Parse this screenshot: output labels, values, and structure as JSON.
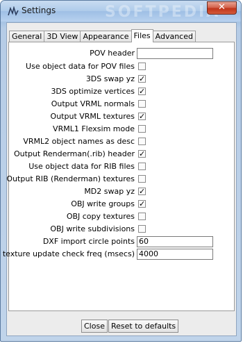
{
  "window": {
    "title": "Settings",
    "watermark": "SOFTPEDIA",
    "close_glyph": "✕"
  },
  "tabs": [
    {
      "label": "General",
      "active": false
    },
    {
      "label": "3D View",
      "active": false
    },
    {
      "label": "Appearance",
      "active": false
    },
    {
      "label": "Files",
      "active": true
    },
    {
      "label": "Advanced",
      "active": false
    }
  ],
  "settings": [
    {
      "label": "POV header",
      "type": "text",
      "value": ""
    },
    {
      "label": "Use object data for POV files",
      "type": "checkbox",
      "checked": false
    },
    {
      "label": "3DS swap yz",
      "type": "checkbox",
      "checked": true
    },
    {
      "label": "3DS optimize vertices",
      "type": "checkbox",
      "checked": true
    },
    {
      "label": "Output VRML normals",
      "type": "checkbox",
      "checked": false
    },
    {
      "label": "Output VRML textures",
      "type": "checkbox",
      "checked": true
    },
    {
      "label": "VRML1 Flexsim mode",
      "type": "checkbox",
      "checked": false
    },
    {
      "label": "VRML2 object names as desc",
      "type": "checkbox",
      "checked": false
    },
    {
      "label": "Output Renderman(.rib) header",
      "type": "checkbox",
      "checked": true
    },
    {
      "label": "Use object data for RIB files",
      "type": "checkbox",
      "checked": false
    },
    {
      "label": "Output RIB (Renderman) textures",
      "type": "checkbox",
      "checked": false
    },
    {
      "label": "MD2 swap yz",
      "type": "checkbox",
      "checked": true
    },
    {
      "label": "OBJ write groups",
      "type": "checkbox",
      "checked": true
    },
    {
      "label": "OBJ copy textures",
      "type": "checkbox",
      "checked": false
    },
    {
      "label": "OBJ write subdivisions",
      "type": "checkbox",
      "checked": false
    },
    {
      "label": "DXF import circle points",
      "type": "text",
      "value": "60"
    },
    {
      "label": "texture update check freq (msecs)",
      "type": "text",
      "value": "4000"
    }
  ],
  "buttons": {
    "close": "Close",
    "reset": "Reset to defaults"
  },
  "check_glyph": "✓"
}
